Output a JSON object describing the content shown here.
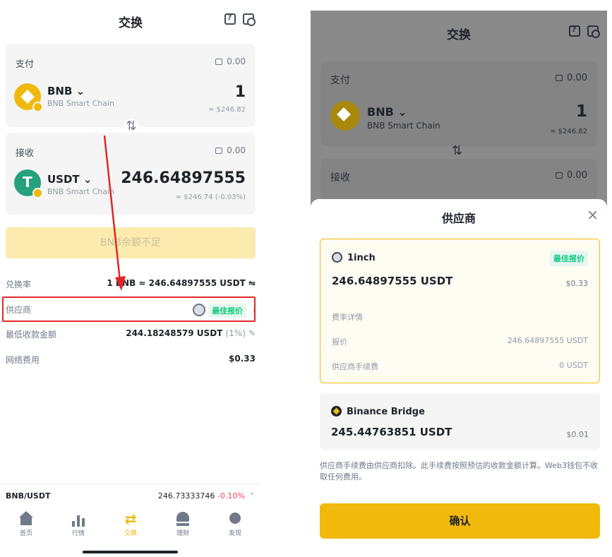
{
  "left": {
    "header": {
      "title": "交换"
    },
    "pay": {
      "label": "支付",
      "balance": "0.00",
      "token": "BNB ⌄",
      "chain": "BNB Smart Chain",
      "amount": "1",
      "usd": "≈ $246.82"
    },
    "receive": {
      "label": "接收",
      "balance": "0.00",
      "token": "USDT ⌄",
      "chain": "BNB Smart Chain",
      "amount": "246.64897555",
      "usd": "≈ $246.74 (-0.03%)"
    },
    "insufficient_button": "BNB余额不足",
    "rate": {
      "label": "兑换率",
      "value": "1 BNB ≈ 246.64897555 USDT ⇋"
    },
    "provider": {
      "label": "供应商",
      "tag": "最佳报价"
    },
    "min_receive": {
      "label": "最低收款金额",
      "value": "244.18248579 USDT",
      "pct": "(1%)"
    },
    "network_fee": {
      "label": "网络费用",
      "value": "$0.33"
    },
    "ticker": {
      "pair": "BNB/USDT",
      "price": "246.73333746",
      "change": "-0.10%"
    },
    "tabs": [
      {
        "label": "首页"
      },
      {
        "label": "行情"
      },
      {
        "label": "交换"
      },
      {
        "label": "理财"
      },
      {
        "label": "发现"
      }
    ]
  },
  "right": {
    "header": {
      "title": "交换"
    },
    "pay": {
      "label": "支付",
      "balance": "0.00",
      "token": "BNB ⌄",
      "chain": "BNB Smart Chain",
      "amount": "1",
      "usd": "≈ $246.82"
    },
    "receive": {
      "label": "接收",
      "balance": "0.00"
    },
    "sheet": {
      "title": "供应商",
      "close": "×",
      "providers": [
        {
          "name": "1inch",
          "tag": "最佳报价",
          "amount": "246.64897555 USDT",
          "fee": "$0.33",
          "details_title": "费率详情",
          "quote_label": "报价",
          "quote_value": "246.64897555 USDT",
          "provider_fee_label": "供应商手续费",
          "provider_fee_value": "0 USDT"
        },
        {
          "name": "Binance Bridge",
          "amount": "245.44763851 USDT",
          "fee": "$0.01"
        }
      ],
      "note": "供应商手续费由供应商扣除。此手续费按照预估的收款金额计算。Web3钱包不收取任何费用。",
      "confirm": "确认"
    }
  },
  "colors": {
    "accent": "#f0b90b",
    "positive": "#0ecb81",
    "negative": "#f6465d",
    "highlight": "#e02727"
  }
}
